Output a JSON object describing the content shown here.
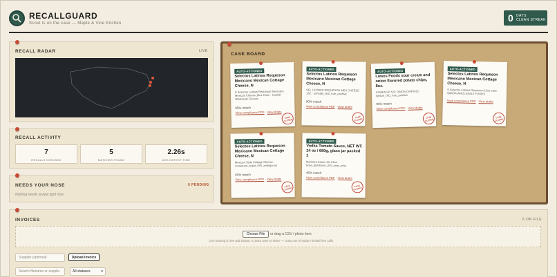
{
  "header": {
    "brand": "RECALLGUARD",
    "tagline": "Scout is on the case — Maple & Vine Kitchen",
    "streak": {
      "count": "0",
      "label_line1": "DAYS",
      "label_line2": "CLEAN STREAK"
    }
  },
  "radar": {
    "title": "RECALL RADAR",
    "status": "LIVE"
  },
  "activity": {
    "title": "RECALL ACTIVITY",
    "stats": [
      {
        "value": "7",
        "label": "RECALLS CHECKED"
      },
      {
        "value": "5",
        "label": "MATCHES FOUND"
      },
      {
        "value": "2.26s",
        "label": "AVG DETECT TIME"
      }
    ]
  },
  "nose": {
    "title": "NEEDS YOUR NOSE",
    "pending": "0 PENDING",
    "empty": "Nothing needs review right now."
  },
  "board": {
    "title": "CASE BOARD",
    "cards": [
      {
        "badge": "AUTO-ACTIONED",
        "title": "Selectos Latinos Requeson Mexicano Mexican Cottage Cheese, N",
        "desc": "S Selectos Latinos Requeson Mexicano Mexican Cheese 16oz Case · Capital Wholesale Grocers",
        "match": "95% match",
        "link1": "View compliance PDF",
        "sep": "·",
        "link2": "View drafts",
        "seal": "CASE CLOSED"
      },
      {
        "badge": "AUTO-ACTIONED",
        "title": "Selectos Latinos Requeson Mexicano Mexican Cottage Cheese, N",
        "desc": "SEL LATINOS REQUESON MEX CHEESE 1SZ · orthside_002_true_positive",
        "match": "90% match",
        "link1": "View compliance PDF",
        "sep": "·",
        "link2": "View drafts",
        "seal": "CASE CLOSED"
      },
      {
        "badge": "AUTO-ACTIONED",
        "title": "Lowes Foods sour cream and onion flavored potato chips, 8oz.",
        "desc": "LOWES FD S/C ONION CHIPS 8Z · rgetcm_001_true_positive",
        "match": "95% match",
        "link1": "View compliance PDF",
        "sep": "·",
        "link2": "View drafts",
        "seal": "CASE CLOSED"
      },
      {
        "badge": "AUTO-ACTIONED",
        "title": "Selectos Latinos Requeson Mexicano Mexican Cottage Cheese, N",
        "desc": "S Selectos Latinos Requeson 16oz case · SARDA WHOLESALE FOODS",
        "match": "",
        "link1": "View compliance PDF",
        "sep": "·",
        "link2": "View drafts",
        "seal": "CASE CLOSED"
      },
      {
        "badge": "AUTO-ACTIONED",
        "title": "Selectos Latinos Requeson Mexicano Mexican Cottage Cheese, N",
        "desc": "Mexican Style Cottage Cheese · restaurant_depot_005_ambiguous",
        "match": "60% match",
        "link1": "View compliance PDF",
        "sep": "·",
        "link2": "View drafts",
        "seal": "CASE CLOSED"
      },
      {
        "badge": "AUTO-ACTIONED",
        "title": "Vodka Tomato Sauce, NET WT. 24 oz / 680g, glass jar packed 1",
        "desc": "Marinara Sauce Jar 24oz · bond_distributor_003_near_miss",
        "match": "45% match",
        "link1": "View compliance PDF",
        "sep": "·",
        "link2": "View drafts",
        "seal": "CASE CLOSED"
      }
    ]
  },
  "invoices": {
    "title": "INVOICES",
    "count": "6 ON FILE",
    "choose_file": "Choose File",
    "drop_text": "or drag a CSV / photo here",
    "note": "CSV parsing is free and instant. A photo uses AI vision — costs one of today's limited free calls.",
    "supplier_placeholder": "Supplier (optional)",
    "upload": "Upload invoice",
    "search_placeholder": "Search filename or supplie",
    "status_filter": "All statuses"
  }
}
